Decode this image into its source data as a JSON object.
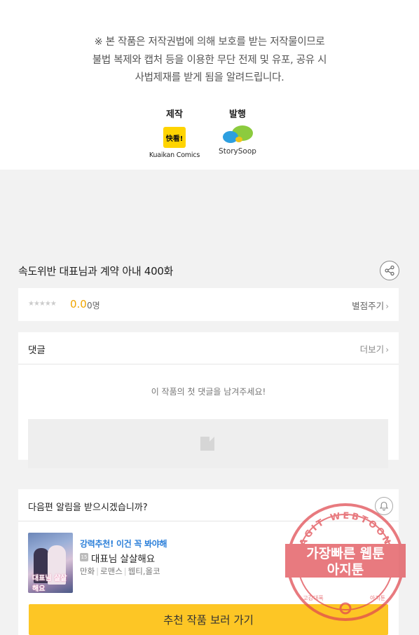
{
  "notice": {
    "lines": [
      "※ 본 작품은 저작권법에 의해 보호를 받는 저작물이므로",
      "불법 복제와 캡처 등을 이용한 무단 전제 및 유포, 공유 시",
      "사법제재를 받게 됨을 알려드립니다."
    ],
    "production_label": "제작",
    "production_logo_text": "快看!",
    "production_name": "Kuaikan Comics",
    "publisher_label": "발행",
    "publisher_name": "StorySoop"
  },
  "episode": {
    "title": "속도위반 대표님과 계약 아내 400화",
    "share_icon": "share-icon"
  },
  "rating": {
    "stars": "★★★★★",
    "score": "0.0",
    "votes": "0명",
    "rate_link": "별점주기",
    "chevron": "›",
    "star_color": "#cccccc",
    "score_color": "#f0a500"
  },
  "comments": {
    "title": "댓글",
    "more_link": "더보기",
    "empty_text": "이 작품의 첫 댓글을 남겨주세요!"
  },
  "next_episode": {
    "question": "다음편 알림을 받으시겠습니까?",
    "bell_icon": "bell-icon",
    "recommend_label": "강력추천! 이건 꼭 봐야해",
    "age_badge": "15",
    "work_title": "대표님 살살해요",
    "genres": [
      "만화",
      "로맨스",
      "웹티,올코"
    ],
    "thumb_text": "대표님 살살해요",
    "button_label": "추천 작품 보러 가기",
    "accent_color": "#fdc625",
    "link_color": "#2b7fd9"
  },
  "watermark": {
    "arc_text": "AGIT WEBTOON",
    "line1": "가장빠른 웹툰",
    "line2": "아지툰",
    "bottom_left": "고감대폭",
    "bottom_right": "아지툰",
    "color": "#e0484f"
  }
}
